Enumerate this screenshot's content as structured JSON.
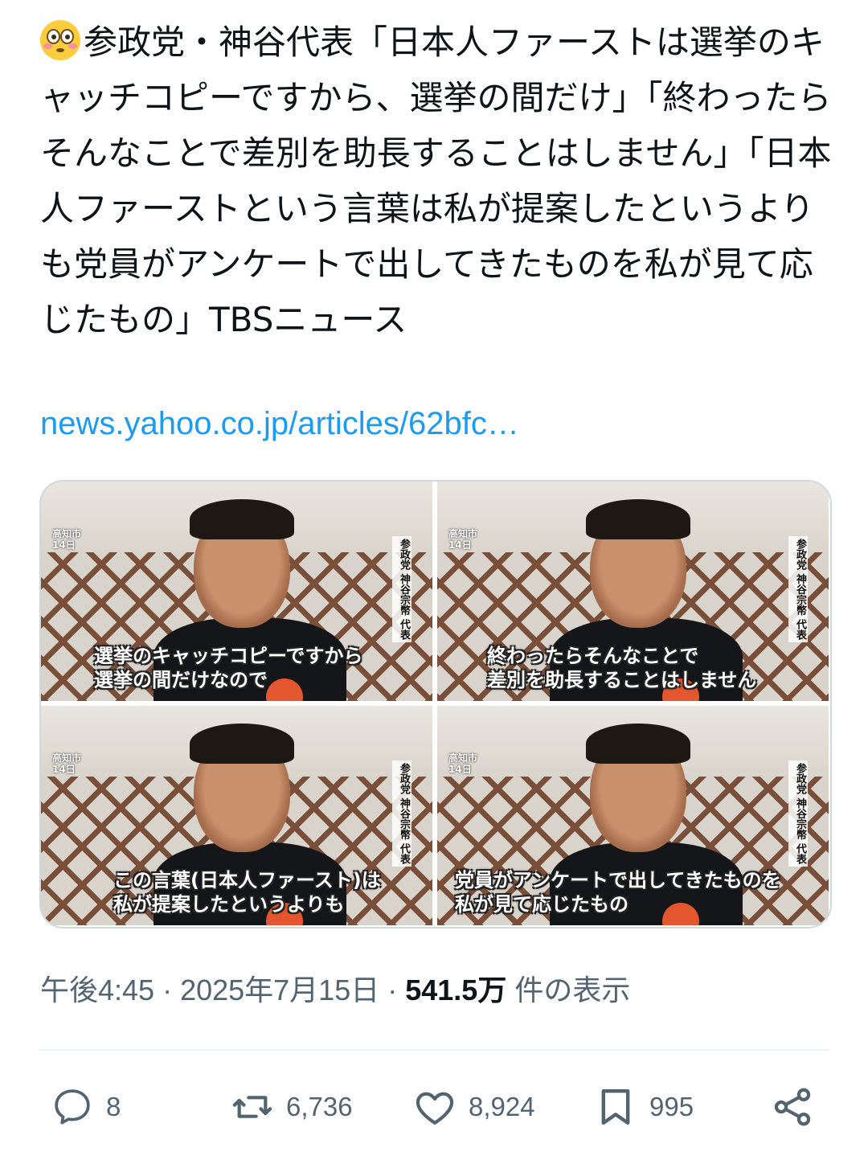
{
  "tweet": {
    "emoji": "flushed-face-icon",
    "text": "参政党・神谷代表「日本人ファーストは選挙のキャッチコピーですから、選挙の間だけ」「終わったらそんなことで差別を助長することはしません」「日本人ファーストという言葉は私が提案したというよりも党員がアンケートで出してきたものを私が見て応じたもの」TBSニュース",
    "link": "news.yahoo.co.jp/articles/62bfc…"
  },
  "media": {
    "frames": [
      {
        "place": "高知市\n14日",
        "vertical": "参政党 神谷宗幣 代表",
        "caption": "選挙のキャッチコピーですから\n選挙の間だけなので"
      },
      {
        "place": "高知市\n14日",
        "vertical": "参政党 神谷宗幣 代表",
        "caption": "終わったらそんなことで\n差別を助長することはしません"
      },
      {
        "place": "高知市\n14日",
        "vertical": "参政党 神谷宗幣 代表",
        "caption": "この言葉(日本人ファースト)は\n私が提案したというよりも"
      },
      {
        "place": "高知市\n14日",
        "vertical": "参政党 神谷宗幣 代表",
        "caption": "党員がアンケートで出してきたものを\n私が見て応じたもの"
      }
    ]
  },
  "meta": {
    "time": "午後4:45",
    "sep1": " · ",
    "date": "2025年7月15日",
    "sep2": " · ",
    "views": "541.5万",
    "views_label": " 件の表示"
  },
  "actions": {
    "reply": {
      "icon": "reply-icon",
      "count": "8"
    },
    "retweet": {
      "icon": "retweet-icon",
      "count": "6,736"
    },
    "like": {
      "icon": "heart-icon",
      "count": "8,924"
    },
    "bookmark": {
      "icon": "bookmark-icon",
      "count": "995"
    },
    "share": {
      "icon": "share-icon"
    }
  },
  "colors": {
    "link": "#1d9bf0",
    "muted": "#536471",
    "text": "#0f1419"
  }
}
